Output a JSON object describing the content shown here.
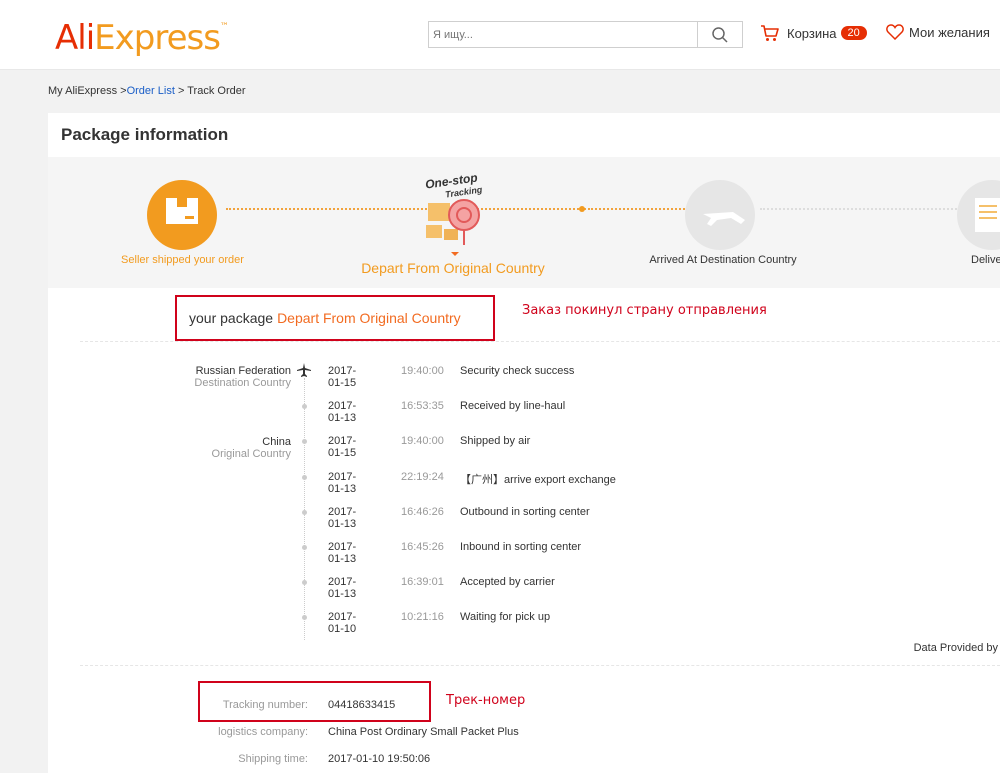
{
  "header": {
    "logo_ali": "Ali",
    "logo_express": "Express",
    "logo_tm": "™",
    "search_placeholder": "Я ищу...",
    "cart_label": "Корзина",
    "cart_count": "20",
    "wishlist_label": "Мои желания",
    "colors": {
      "brand_red": "#e62e04",
      "brand_orange": "#f29b1f"
    }
  },
  "breadcrumb": {
    "home": "My AliExpress",
    "sep1": ">",
    "order_list": "Order List",
    "sep2": ">",
    "current": "Track Order"
  },
  "panel": {
    "title": "Package information"
  },
  "steps": [
    {
      "label": "Seller shipped your order",
      "icon": "box-icon",
      "state": "done"
    },
    {
      "label": "Depart From Original Country",
      "icon": "one-stop-tracking-icon",
      "state": "current",
      "badge_line1": "One-stop",
      "badge_line2": "Tracking"
    },
    {
      "label": "Arrived At Destination Country",
      "icon": "airplane-icon",
      "state": "pending"
    },
    {
      "label": "Delive",
      "icon": "delivery-icon",
      "state": "pending"
    }
  ],
  "status": {
    "prefix": "your package",
    "highlight": "Depart From Original Country",
    "annotation": "Заказ покинул страну отправления"
  },
  "countries": [
    {
      "name": "Russian Federation",
      "role": "Destination Country"
    },
    {
      "name": "China",
      "role": "Original Country"
    }
  ],
  "events": [
    {
      "date": "2017-01-15",
      "time": "19:40:00",
      "desc": "Security check success"
    },
    {
      "date": "2017-01-13",
      "time": "16:53:35",
      "desc": "Received by line-haul"
    },
    {
      "date": "2017-01-15",
      "time": "19:40:00",
      "desc": "Shipped by air"
    },
    {
      "date": "2017-01-13",
      "time": "22:19:24",
      "desc": "【广州】arrive export exchange"
    },
    {
      "date": "2017-01-13",
      "time": "16:46:26",
      "desc": "Outbound in sorting center"
    },
    {
      "date": "2017-01-13",
      "time": "16:45:26",
      "desc": "Inbound in sorting center"
    },
    {
      "date": "2017-01-13",
      "time": "16:39:01",
      "desc": "Accepted by carrier"
    },
    {
      "date": "2017-01-10",
      "time": "10:21:16",
      "desc": "Waiting for pick up"
    }
  ],
  "data_provided": "Data Provided by",
  "shipment": {
    "tracking_label": "Tracking number:",
    "tracking_value": "04418633415",
    "tracking_annotation": "Трек-номер",
    "logistics_label": "logistics company:",
    "logistics_value": "China Post Ordinary Small Packet Plus",
    "shipping_label": "Shipping time:",
    "shipping_value": "2017-01-10 19:50:06"
  }
}
